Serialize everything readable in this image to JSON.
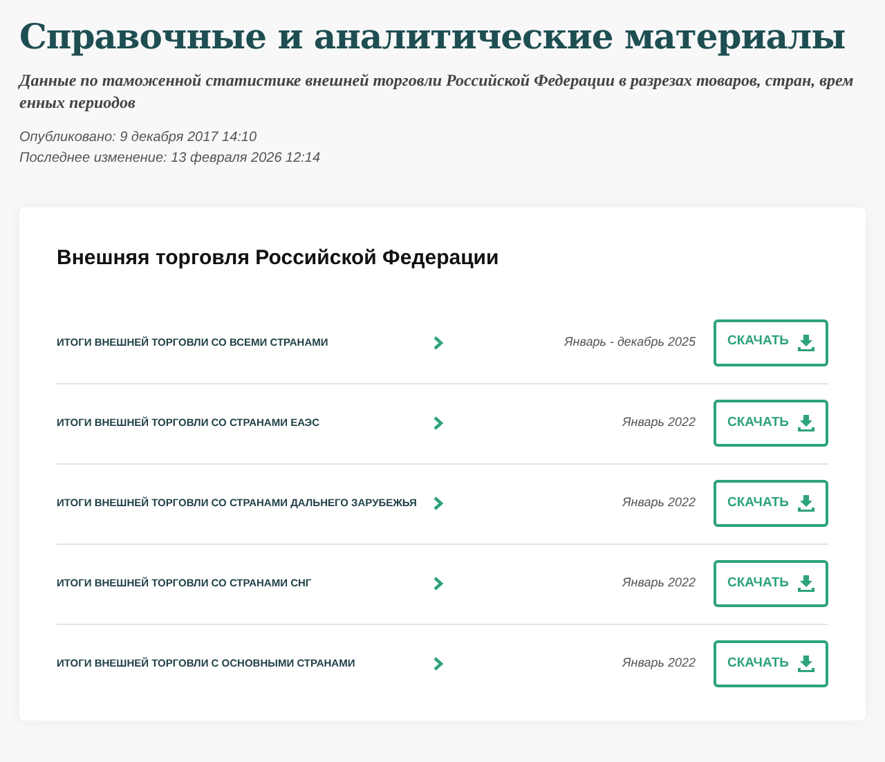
{
  "page": {
    "title": "Справочные и аналитические материалы",
    "subtitle": "Данные по таможенной статистике внешней торговли Российской Федерации в разрезах товаров, стран, временных периодов",
    "published": "Опубликовано: 9 декабря 2017 14:10",
    "modified": "Последнее изменение: 13 февраля 2026 12:14"
  },
  "card": {
    "title": "Внешняя торговля Российской Федерации",
    "rows": [
      {
        "name": "ИТОГИ ВНЕШНЕЙ ТОРГОВЛИ СО ВСЕМИ СТРАНАМИ",
        "period": "Январь - декабрь 2025",
        "button": "СКАЧАТЬ"
      },
      {
        "name": "ИТОГИ ВНЕШНЕЙ ТОРГОВЛИ СО СТРАНАМИ ЕАЭС",
        "period": "Январь 2022",
        "button": "СКАЧАТЬ"
      },
      {
        "name": "ИТОГИ ВНЕШНЕЙ ТОРГОВЛИ СО СТРАНАМИ ДАЛЬНЕГО ЗАРУБЕЖЬЯ",
        "period": "Январь 2022",
        "button": "СКАЧАТЬ"
      },
      {
        "name": "ИТОГИ ВНЕШНЕЙ ТОРГОВЛИ СО СТРАНАМИ СНГ",
        "period": "Январь 2022",
        "button": "СКАЧАТЬ"
      },
      {
        "name": "ИТОГИ ВНЕШНЕЙ ТОРГОВЛИ С ОСНОВНЫМИ СТРАНАМИ",
        "period": "Январь 2022",
        "button": "СКАЧАТЬ"
      }
    ]
  }
}
